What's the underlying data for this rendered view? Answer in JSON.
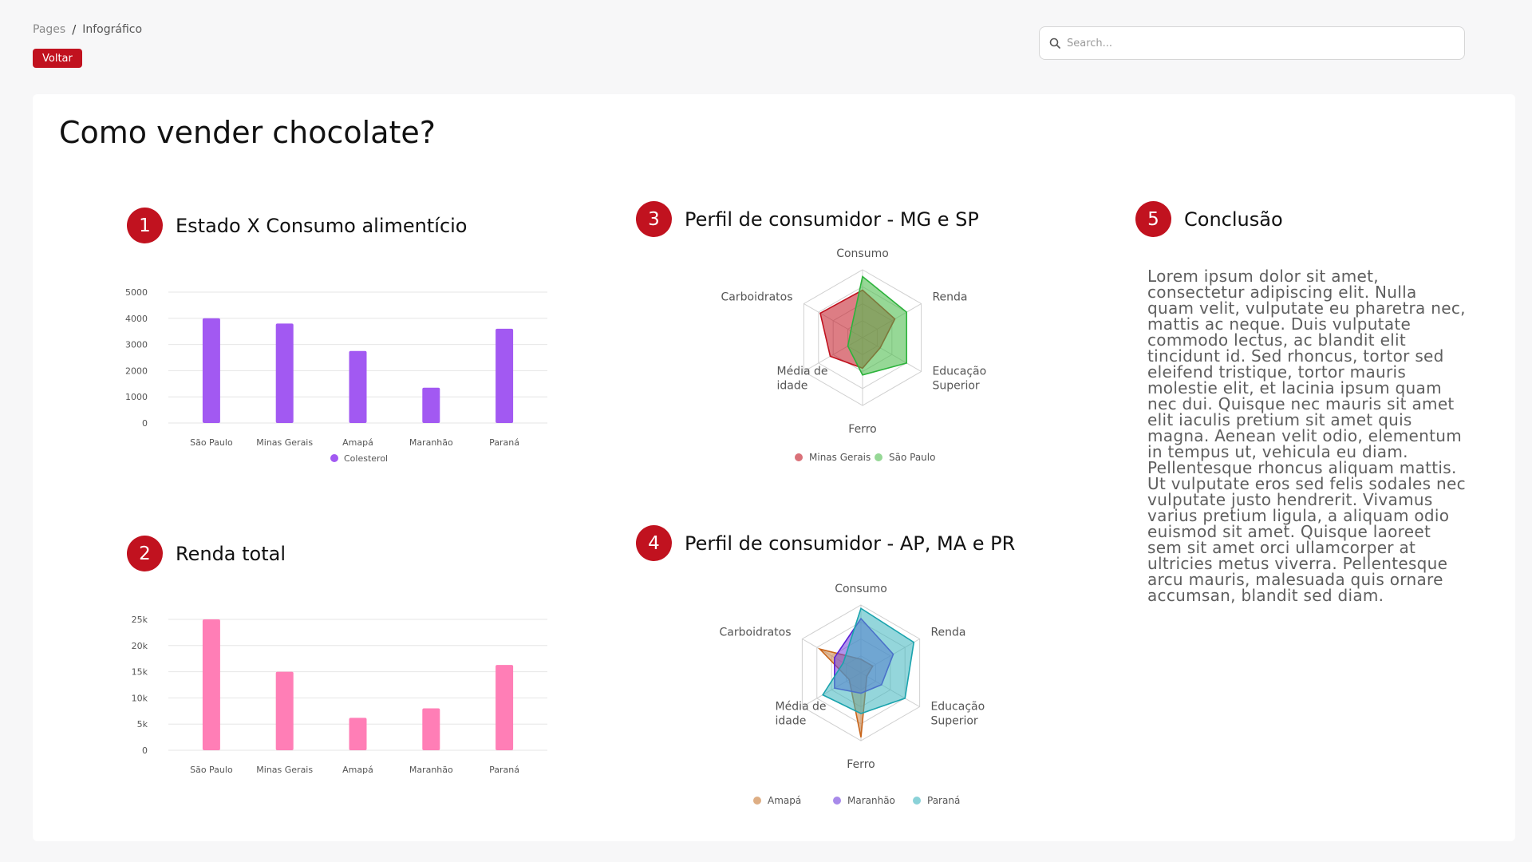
{
  "breadcrumb": {
    "root": "Pages",
    "current": "Infográfico"
  },
  "back_button": "Voltar",
  "search": {
    "placeholder": "Search..."
  },
  "page_title": "Como vender chocolate?",
  "sections": {
    "s1": {
      "number": "1",
      "title": "Estado X Consumo alimentício"
    },
    "s2": {
      "number": "2",
      "title": "Renda total"
    },
    "s3": {
      "number": "3",
      "title": "Perfil de consumidor - MG e SP"
    },
    "s4": {
      "number": "4",
      "title": "Perfil de consumidor - AP, MA e PR"
    },
    "s5": {
      "number": "5",
      "title": "Conclusão"
    }
  },
  "conclusion_text": "Lorem ipsum dolor sit amet, consectetur adipiscing elit. Nulla quam velit, vulputate eu pharetra nec, mattis ac neque. Duis vulputate commodo lectus, ac blandit elit tincidunt id. Sed rhoncus, tortor sed eleifend tristique, tortor mauris molestie elit, et lacinia ipsum quam nec dui. Quisque nec mauris sit amet elit iaculis pretium sit amet quis magna. Aenean velit odio, elementum in tempus ut, vehicula eu diam. Pellentesque rhoncus aliquam mattis. Ut vulputate eros sed felis sodales nec vulputate justo hendrerit. Vivamus varius pretium ligula, a aliquam odio euismod sit amet. Quisque laoreet sem sit amet orci ullamcorper at ultricies metus viverra. Pellentesque arcu mauris, malesuada quis ornare accumsan, blandit sed diam.",
  "colors": {
    "accent": "#c1121f",
    "bar1": "#a259f2",
    "bar2": "#ff7eb6"
  },
  "chart_data": [
    {
      "type": "bar",
      "categories": [
        "São Paulo",
        "Minas Gerais",
        "Amapá",
        "Maranhão",
        "Paraná"
      ],
      "series": [
        {
          "name": "Colesterol",
          "values": [
            4000,
            3800,
            2750,
            1350,
            3600
          ],
          "color": "#a259f2"
        }
      ],
      "yticks": [
        "0",
        "1000",
        "2000",
        "3000",
        "4000",
        "5000"
      ],
      "ylim": [
        0,
        5000
      ],
      "legend": "bottom"
    },
    {
      "type": "bar",
      "categories": [
        "São Paulo",
        "Minas Gerais",
        "Amapá",
        "Maranhão",
        "Paraná"
      ],
      "series": [
        {
          "values": [
            25000,
            15000,
            6200,
            8000,
            16300
          ],
          "color": "#ff7eb6"
        }
      ],
      "yticks": [
        "0",
        "5k",
        "10k",
        "15k",
        "20k",
        "25k"
      ],
      "ylim": [
        0,
        25000
      ]
    },
    {
      "type": "radar",
      "axes": [
        "Consumo",
        "Renda",
        "Educação Superior",
        "Ferro",
        "Média de idade",
        "Carboidratos"
      ],
      "max": 1,
      "series": [
        {
          "name": "Minas Gerais",
          "values": [
            0.7,
            0.55,
            0.3,
            0.45,
            0.55,
            0.72
          ],
          "color": "#c1121f",
          "fill": "rgba(193,18,31,0.55)"
        },
        {
          "name": "São Paulo",
          "values": [
            0.9,
            0.75,
            0.75,
            0.55,
            0.25,
            0.2
          ],
          "color": "#2db33c",
          "fill": "rgba(80,190,80,0.6)"
        }
      ],
      "legend": "bottom"
    },
    {
      "type": "radar",
      "axes": [
        "Consumo",
        "Renda",
        "Educação Superior",
        "Ferro",
        "Média de idade",
        "Carboidratos"
      ],
      "max": 1,
      "series": [
        {
          "name": "Amapá",
          "values": [
            0.2,
            0.2,
            0.1,
            0.95,
            0.2,
            0.7
          ],
          "color": "#c8651b",
          "fill": "rgba(200,120,50,0.5)"
        },
        {
          "name": "Maranhão",
          "values": [
            0.8,
            0.55,
            0.35,
            0.3,
            0.45,
            0.45
          ],
          "color": "#5b1fd8",
          "fill": "rgba(110,60,220,0.55)"
        },
        {
          "name": "Paraná",
          "values": [
            0.95,
            0.9,
            0.75,
            0.6,
            0.65,
            0.3
          ],
          "color": "#1aa3ad",
          "fill": "rgba(60,180,190,0.55)"
        }
      ],
      "legend": "bottom"
    }
  ]
}
